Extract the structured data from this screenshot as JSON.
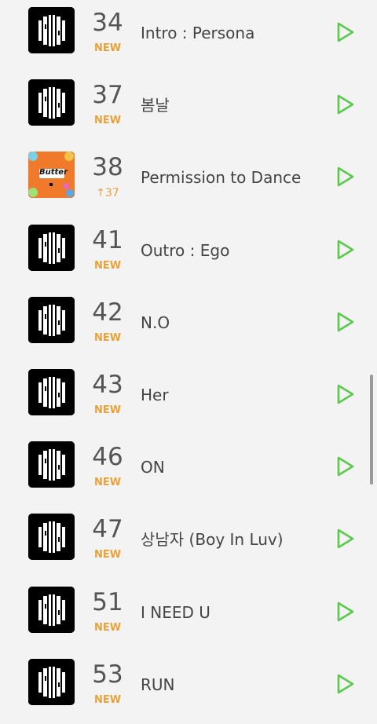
{
  "chart_list": {
    "songs": [
      {
        "rank": "34",
        "status": "NEW",
        "title": "Intro : Persona",
        "cover": "proof-album-icon"
      },
      {
        "rank": "37",
        "status": "NEW",
        "title": "봄날",
        "cover": "proof-album-icon"
      },
      {
        "rank": "38",
        "status": "↑37",
        "title": "Permission to Dance",
        "cover": "butter-album-icon",
        "cover_text": "Butter"
      },
      {
        "rank": "41",
        "status": "NEW",
        "title": "Outro : Ego",
        "cover": "proof-album-icon"
      },
      {
        "rank": "42",
        "status": "NEW",
        "title": "N.O",
        "cover": "proof-album-icon"
      },
      {
        "rank": "43",
        "status": "NEW",
        "title": "Her",
        "cover": "proof-album-icon"
      },
      {
        "rank": "46",
        "status": "NEW",
        "title": "ON",
        "cover": "proof-album-icon"
      },
      {
        "rank": "47",
        "status": "NEW",
        "title": "상남자 (Boy In Luv)",
        "cover": "proof-album-icon"
      },
      {
        "rank": "51",
        "status": "NEW",
        "title": "I NEED U",
        "cover": "proof-album-icon"
      },
      {
        "rank": "53",
        "status": "NEW",
        "title": "RUN",
        "cover": "proof-album-icon"
      }
    ]
  },
  "play_icon": "play-icon",
  "colors": {
    "background": "#f3f3f3",
    "rank_text": "#555555",
    "status_new": "#e8a23a",
    "play_green": "#5ac94e",
    "butter_orange": "#f07a2a"
  }
}
